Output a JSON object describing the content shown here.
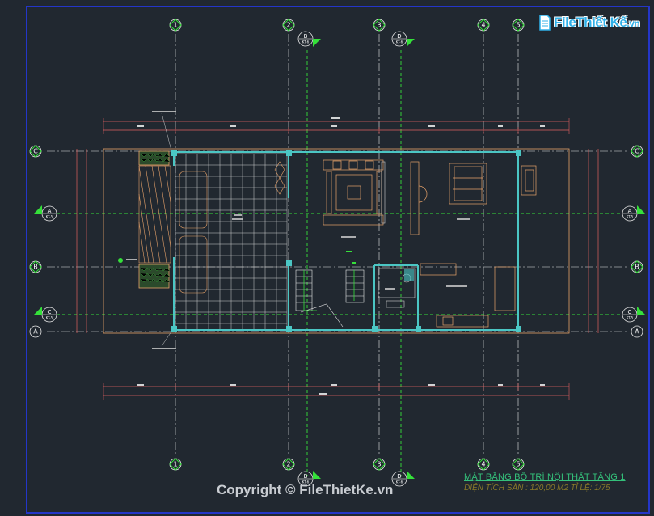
{
  "watermark": {
    "brand_main": "File",
    "brand_mid": "Thiết Kế",
    "brand_tld": ".vn",
    "copyright": "Copyright © FileThietKe.vn"
  },
  "title_block": {
    "title": "MẶT BẰNG BỐ TRÍ NỘI THẤT TẦNG 1",
    "subtitle": "DIỆN TÍCH SÀN : 120,00 M2  TỈ LỆ: 1/75"
  },
  "grid_top": [
    "1",
    "2",
    "3",
    "4",
    "5"
  ],
  "grid_side": [
    "C",
    "B",
    "A"
  ],
  "section_marks": [
    "B",
    "D",
    "A",
    "C"
  ],
  "section_sheet": "KT-5",
  "section_sheet_top": "KT-6",
  "colors": {
    "background": "#212830",
    "grid": "#ffffff",
    "section": "#35e03a",
    "wall": "#4bc6c4",
    "dimension": "#e06060",
    "furniture": "#d98a5a",
    "tile": "#cfcfcf",
    "hedge": "#3fae3f"
  }
}
